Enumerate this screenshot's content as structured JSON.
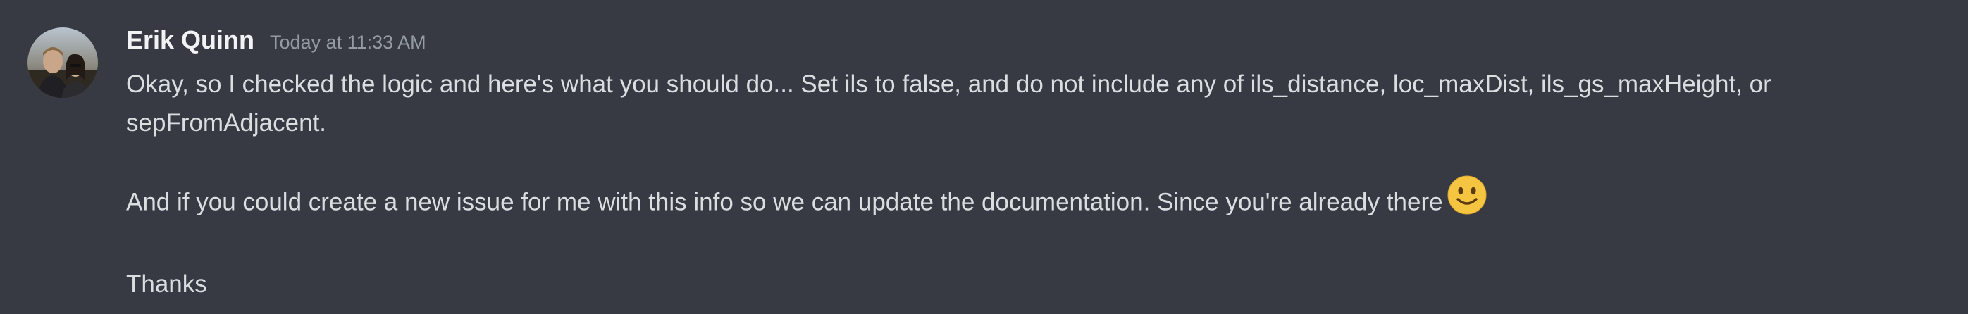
{
  "message": {
    "author": "Erik Quinn",
    "timestamp": "Today at 11:33 AM",
    "avatar_icon": "user-avatar-photo",
    "paragraphs": [
      "Okay, so I checked the logic and here's what you should do... Set ils to false, and do not include any of ils_distance, loc_maxDist, ils_gs_maxHeight, or sepFromAdjacent.",
      "And if you could create a new issue for me with this info so we can update the documentation. Since you're already there",
      "Thanks"
    ],
    "emoji": "slightly-smiling-face-icon"
  },
  "colors": {
    "background": "#373a43",
    "author": "#f2f3f5",
    "timestamp": "#949ba4",
    "text": "#dbdee1",
    "emoji": "#f5c542"
  }
}
